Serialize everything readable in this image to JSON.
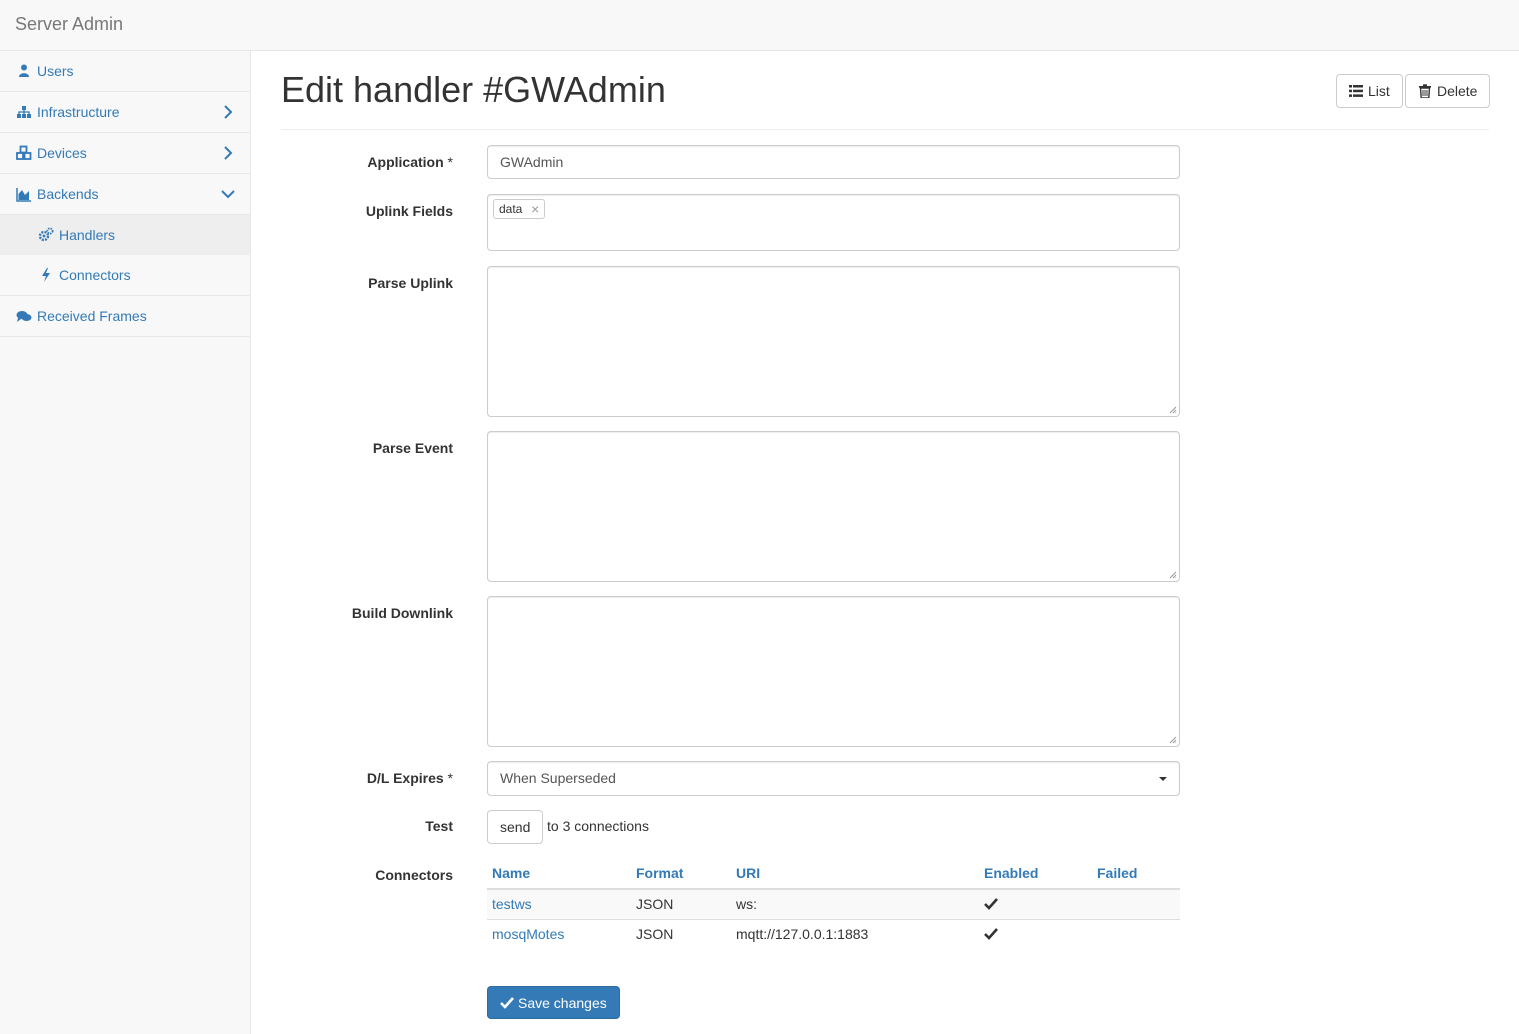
{
  "app": {
    "brand": "Server Admin"
  },
  "sidebar": {
    "items": [
      {
        "label": "Users",
        "icon": "user-icon"
      },
      {
        "label": "Infrastructure",
        "icon": "sitemap-icon",
        "chevron": "chevron-right-icon"
      },
      {
        "label": "Devices",
        "icon": "cubes-icon",
        "chevron": "chevron-right-icon"
      },
      {
        "label": "Backends",
        "icon": "area-chart-icon",
        "chevron": "chevron-down-icon",
        "children": [
          {
            "label": "Handlers",
            "icon": "cogs-icon",
            "active": true
          },
          {
            "label": "Connectors",
            "icon": "bolt-icon"
          }
        ]
      },
      {
        "label": "Received Frames",
        "icon": "comments-icon"
      }
    ]
  },
  "header": {
    "title": "Edit handler #GWAdmin",
    "list_label": "List",
    "delete_label": "Delete"
  },
  "form": {
    "application": {
      "label": "Application",
      "required": "*",
      "value": "GWAdmin"
    },
    "uplink_fields": {
      "label": "Uplink Fields",
      "tags": [
        "data"
      ]
    },
    "parse_uplink": {
      "label": "Parse Uplink",
      "value": ""
    },
    "parse_event": {
      "label": "Parse Event",
      "value": ""
    },
    "build_downlink": {
      "label": "Build Downlink",
      "value": ""
    },
    "dl_expires": {
      "label": "D/L Expires",
      "required": "*",
      "value": "When Superseded"
    },
    "test": {
      "label": "Test",
      "button": "send",
      "suffix": "to 3 connections"
    },
    "connectors": {
      "label": "Connectors",
      "columns": [
        "Name",
        "Format",
        "URI",
        "Enabled",
        "Failed"
      ],
      "rows": [
        {
          "name": "testws",
          "format": "JSON",
          "uri": "ws:",
          "enabled": true,
          "failed": ""
        },
        {
          "name": "mosqMotes",
          "format": "JSON",
          "uri": "mqtt://127.0.0.1:1883",
          "enabled": true,
          "failed": ""
        }
      ]
    },
    "save_label": "Save changes"
  },
  "colors": {
    "link": "#337ab7",
    "primary": "#337ab7",
    "sidebar_bg": "#f8f8f8",
    "active_bg": "#eeeeee"
  }
}
